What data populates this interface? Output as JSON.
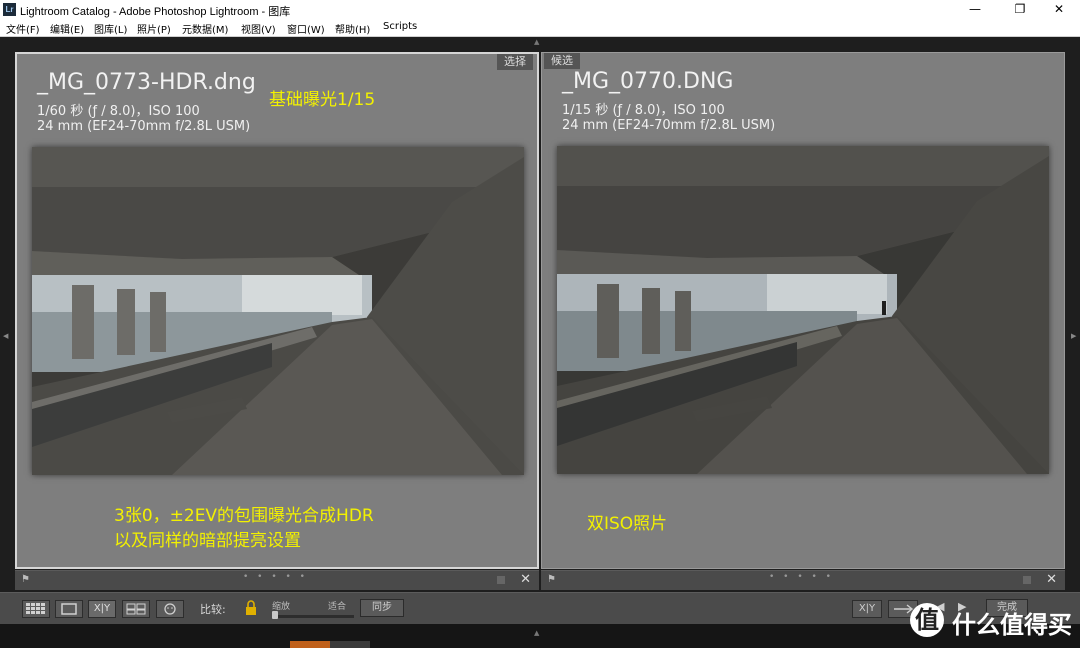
{
  "window": {
    "app_icon_text": "Lr",
    "title": "Lightroom Catalog - Adobe Photoshop Lightroom - 图库",
    "minimize": "—",
    "maximize": "❐",
    "close": "✕"
  },
  "menu": [
    "文件(F)",
    "编辑(E)",
    "图库(L)",
    "照片(P)",
    "元数据(M)",
    "视图(V)",
    "窗口(W)",
    "帮助(H)",
    "Scripts"
  ],
  "left_panel": {
    "tag": "选择",
    "filename": "_MG_0773-HDR.dng",
    "exposure": "1/60 秒 (ƒ / 8.0)，ISO 100",
    "lens": "24 mm (EF24-70mm f/2.8L USM)",
    "note_top": "基础曝光1/15",
    "note_line1": "3张0，±2EV的包围曝光合成HDR",
    "note_line2": "以及同样的暗部提亮设置"
  },
  "right_panel": {
    "tag": "候选",
    "filename": "_MG_0770.DNG",
    "exposure": "1/15 秒 (ƒ / 8.0)，ISO 100",
    "lens": "24 mm (EF24-70mm f/2.8L USM)",
    "note": "双ISO照片"
  },
  "panel_bar": {
    "flag": "⚑",
    "dots": "• • • • •",
    "close": "✕"
  },
  "toolbar": {
    "xy_label": "X|Y",
    "compare_label": "比较:",
    "zoom_label": "缩放",
    "fit_label": "适合",
    "sync_label": "同步",
    "swap_label": "X|Y",
    "done_label": "完成"
  },
  "watermark": {
    "icon": "值",
    "text": "什么值得买"
  },
  "colors": {
    "accent_note": "#f3f100",
    "panel_bg": "#7e7e7e",
    "toolbar_bg": "#4b4b4b"
  }
}
